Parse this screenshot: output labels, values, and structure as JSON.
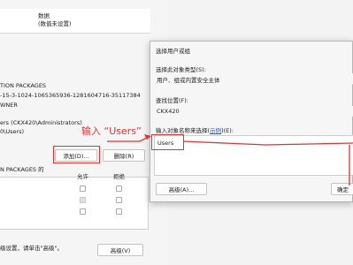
{
  "perm_dialog": {
    "header_col": "数据",
    "header_col_sub": "(数值未设置)",
    "lines": [
      "TION PACKAGES",
      "-15-3-1024-1065365936-1281604716-35117384",
      "WNER"
    ],
    "list_lines": [
      "ers (CKX420\\Administrators)",
      "0\\Users)"
    ],
    "add_button": "添加(D)...",
    "remove_button": "删除(R)",
    "permissions_for": "N PACKAGES 的",
    "allow_header": "允许",
    "deny_header": "拒绝",
    "footer_hint": "级设置，请单击\"高级\"。",
    "advanced_button": "高级(V)"
  },
  "select_dialog": {
    "title": "选择用户或组",
    "object_type_label": "选择此对象类型(S):",
    "object_type_value": "用户、组或内置安全主体",
    "location_label": "查找位置(F):",
    "location_value": "CKX420",
    "enter_names_label_pre": "输入对象名称来选择(",
    "enter_names_link": "示例",
    "enter_names_label_post": ")(E):",
    "names_value": "Users",
    "advanced_button": "高级(A)...",
    "ok_button": "确定"
  },
  "annotation": {
    "label": "输入 “Users”",
    "color": "#e03434"
  }
}
